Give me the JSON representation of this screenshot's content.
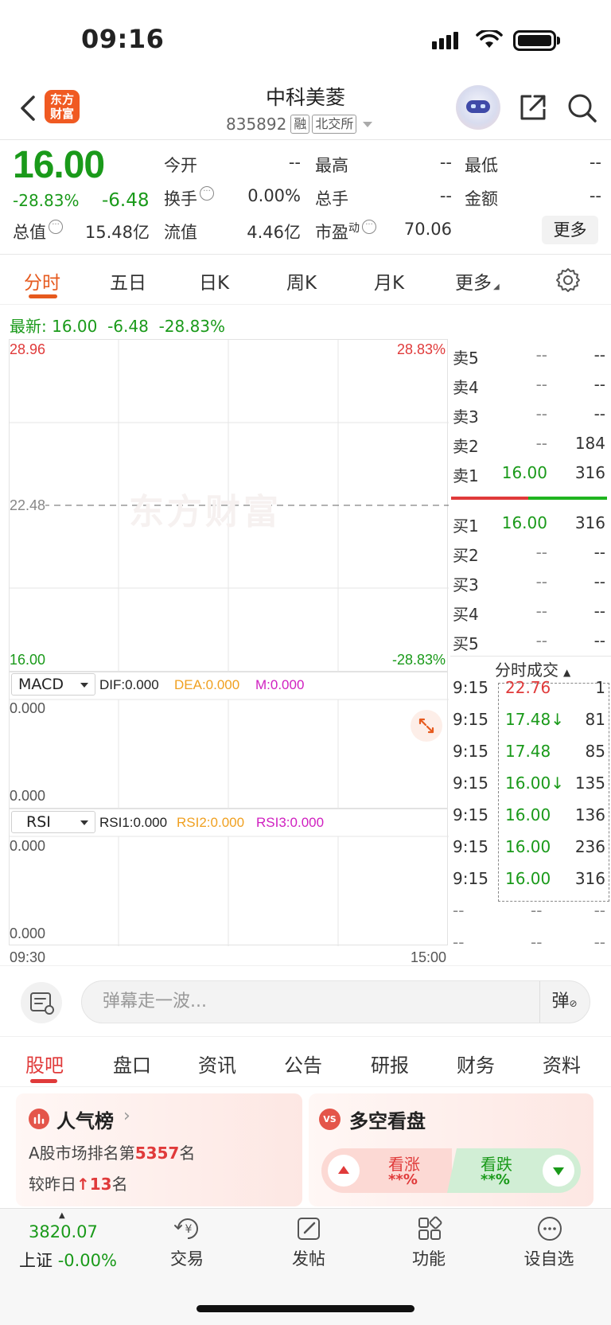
{
  "status_bar": {
    "time": "09:16"
  },
  "header": {
    "logo_text_1": "东方",
    "logo_text_2": "财富",
    "stock_name": "中科美菱",
    "stock_code": "835892",
    "tag_margin": "融",
    "tag_exchange": "北交所"
  },
  "quote": {
    "price": "16.00",
    "change_pct": "-28.83%",
    "change": "-6.48",
    "open_label": "今开",
    "open_value": "--",
    "high_label": "最高",
    "high_value": "--",
    "low_label": "最低",
    "low_value": "--",
    "turnover_label": "换手",
    "turnover_value": "0.00%",
    "volume_label": "总手",
    "volume_value": "--",
    "amount_label": "金额",
    "amount_value": "--",
    "mktcap_label": "总值",
    "mktcap_value": "15.48亿",
    "float_label": "流值",
    "float_value": "4.46亿",
    "pe_label": "市盈",
    "pe_sup": "动",
    "pe_value": "70.06",
    "more_button": "更多"
  },
  "chart_tabs": [
    "分时",
    "五日",
    "日K",
    "周K",
    "月K",
    "更多"
  ],
  "latest": {
    "label": "最新:",
    "price": "16.00",
    "change": "-6.48",
    "pct": "-28.83%"
  },
  "intraday": {
    "y_top": "28.96",
    "y_mid": "22.48",
    "y_bottom": "16.00",
    "pct_top": "28.83%",
    "pct_bottom": "-28.83%",
    "watermark": "东方财富",
    "time_start": "09:30",
    "time_end": "15:00"
  },
  "macd": {
    "name": "MACD",
    "dif": "DIF:0.000",
    "dea": "DEA:0.000",
    "m": "M:0.000",
    "top": "0.000",
    "bottom": "0.000"
  },
  "rsi": {
    "name": "RSI",
    "rsi1": "RSI1:0.000",
    "rsi2": "RSI2:0.000",
    "rsi3": "RSI3:0.000",
    "top": "0.000",
    "bottom": "0.000"
  },
  "order_book": {
    "asks": [
      {
        "label": "卖5",
        "price": "--",
        "vol": "--"
      },
      {
        "label": "卖4",
        "price": "--",
        "vol": "--"
      },
      {
        "label": "卖3",
        "price": "--",
        "vol": "--"
      },
      {
        "label": "卖2",
        "price": "--",
        "vol": "184"
      },
      {
        "label": "卖1",
        "price": "16.00",
        "vol": "316"
      }
    ],
    "bids": [
      {
        "label": "买1",
        "price": "16.00",
        "vol": "316"
      },
      {
        "label": "买2",
        "price": "--",
        "vol": "--"
      },
      {
        "label": "买3",
        "price": "--",
        "vol": "--"
      },
      {
        "label": "买4",
        "price": "--",
        "vol": "--"
      },
      {
        "label": "买5",
        "price": "--",
        "vol": "--"
      }
    ]
  },
  "trades": {
    "header": "分时成交",
    "rows": [
      {
        "time": "9:15",
        "price": "22.76",
        "vol": "1",
        "color": "#e03a3a"
      },
      {
        "time": "9:15",
        "price": "17.48↓",
        "vol": "81",
        "color": "#1a9a1a"
      },
      {
        "time": "9:15",
        "price": "17.48",
        "vol": "85",
        "color": "#1a9a1a"
      },
      {
        "time": "9:15",
        "price": "16.00↓",
        "vol": "135",
        "color": "#1a9a1a"
      },
      {
        "time": "9:15",
        "price": "16.00",
        "vol": "136",
        "color": "#1a9a1a"
      },
      {
        "time": "9:15",
        "price": "16.00",
        "vol": "236",
        "color": "#1a9a1a"
      },
      {
        "time": "9:15",
        "price": "16.00",
        "vol": "316",
        "color": "#1a9a1a"
      },
      {
        "time": "--",
        "price": "--",
        "vol": "--",
        "color": "#888"
      },
      {
        "time": "--",
        "price": "--",
        "vol": "--",
        "color": "#888"
      }
    ]
  },
  "danmu": {
    "placeholder": "弹幕走一波...",
    "button": "弹"
  },
  "section_tabs": [
    "股吧",
    "盘口",
    "资讯",
    "公告",
    "研报",
    "财务",
    "资料"
  ],
  "hot": {
    "title": "人气榜",
    "rank_prefix": "A股市场排名第",
    "rank_value": "5357",
    "rank_suffix": "名",
    "change_prefix": "较昨日",
    "change_value": "13",
    "change_suffix": "名"
  },
  "vs": {
    "badge": "VS",
    "title": "多空看盘",
    "bull_label": "看涨",
    "bull_value": "**%",
    "bear_label": "看跌",
    "bear_value": "**%"
  },
  "bottom_nav": {
    "index_value": "3820.07",
    "index_name": "上证",
    "index_change": "-0.00%",
    "trade": "交易",
    "post": "发帖",
    "features": "功能",
    "watchlist": "设自选"
  },
  "colors": {
    "up": "#e03a3a",
    "down": "#1a9a1a",
    "accent": "#e65a1e"
  }
}
